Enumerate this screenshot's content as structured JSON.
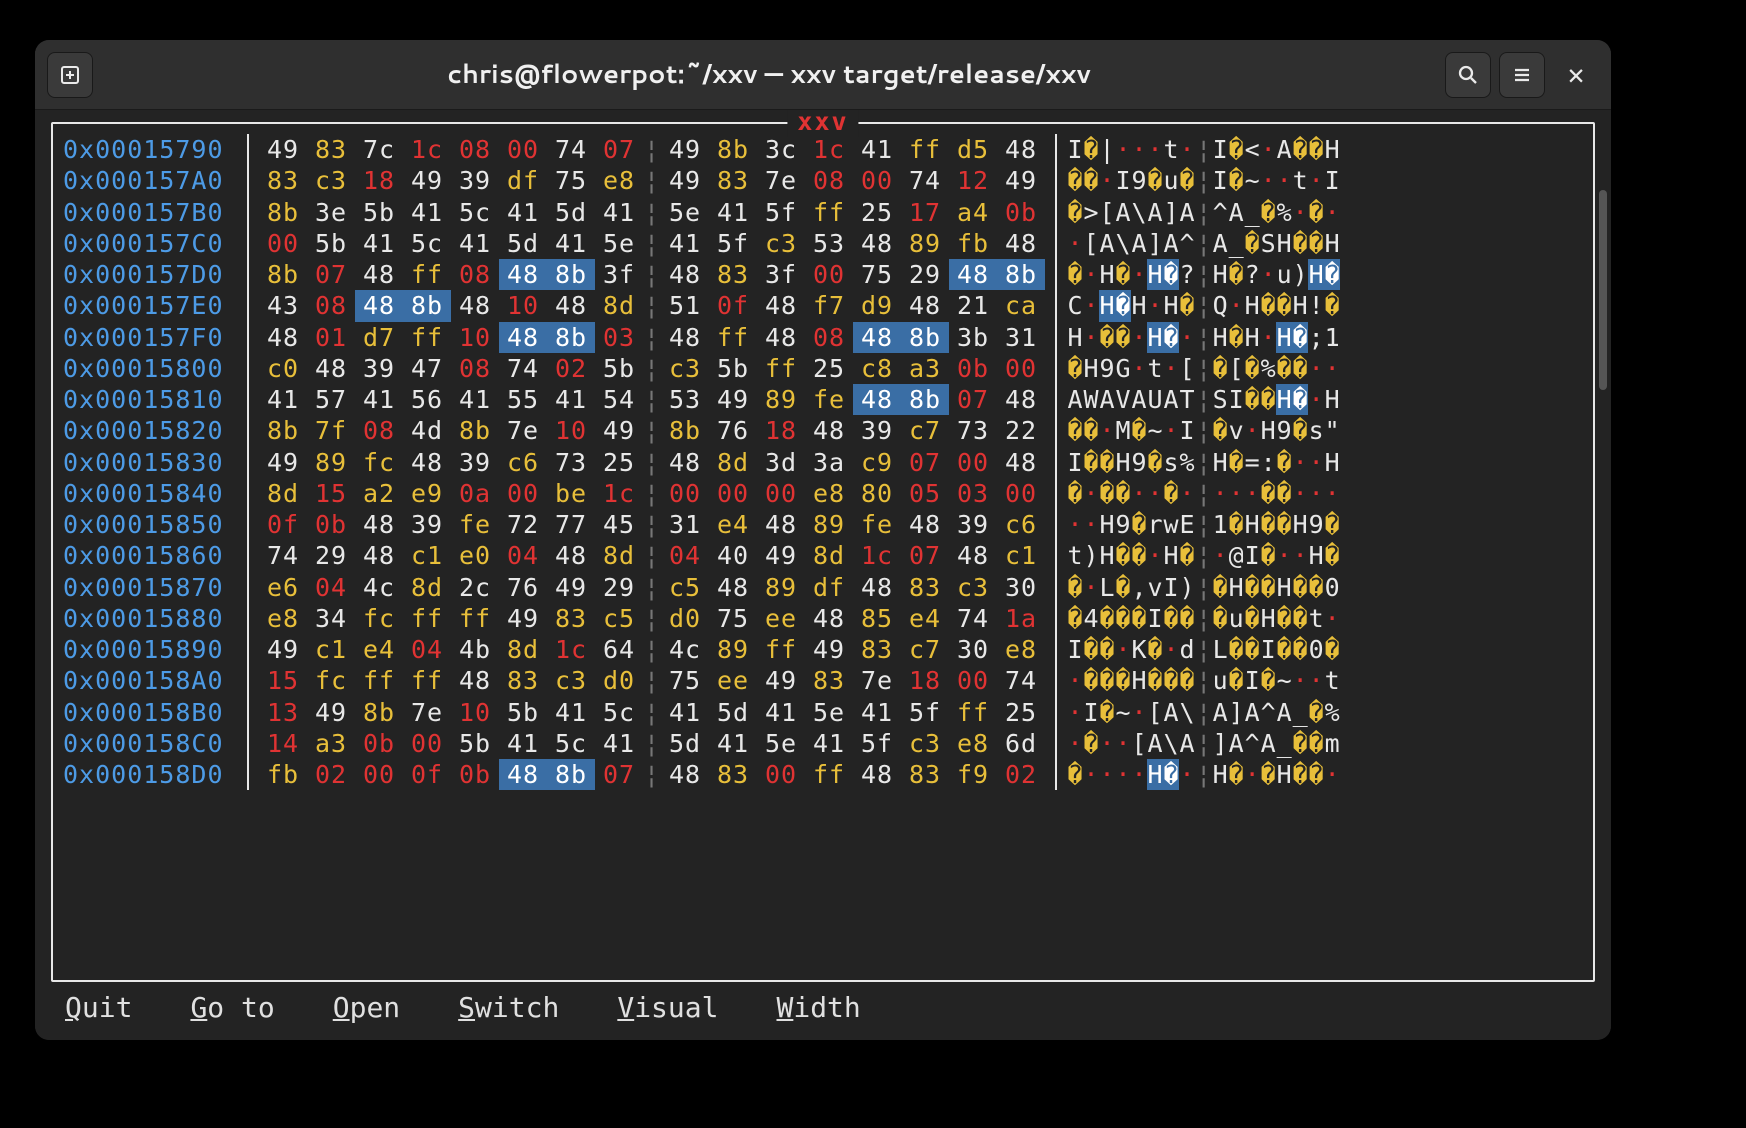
{
  "window": {
    "title": "chris@flowerpot:~/xxv — xxv target/release/xxv"
  },
  "viewer": {
    "title": "xxv",
    "highlight_pattern": [
      "48",
      "8b"
    ],
    "rows": [
      {
        "addr": "0x00015790",
        "bytes": [
          "49",
          "83",
          "7c",
          "1c",
          "08",
          "00",
          "74",
          "07",
          "49",
          "8b",
          "3c",
          "1c",
          "41",
          "ff",
          "d5",
          "48"
        ]
      },
      {
        "addr": "0x000157A0",
        "bytes": [
          "83",
          "c3",
          "18",
          "49",
          "39",
          "df",
          "75",
          "e8",
          "49",
          "83",
          "7e",
          "08",
          "00",
          "74",
          "12",
          "49"
        ]
      },
      {
        "addr": "0x000157B0",
        "bytes": [
          "8b",
          "3e",
          "5b",
          "41",
          "5c",
          "41",
          "5d",
          "41",
          "5e",
          "41",
          "5f",
          "ff",
          "25",
          "17",
          "a4",
          "0b"
        ]
      },
      {
        "addr": "0x000157C0",
        "bytes": [
          "00",
          "5b",
          "41",
          "5c",
          "41",
          "5d",
          "41",
          "5e",
          "41",
          "5f",
          "c3",
          "53",
          "48",
          "89",
          "fb",
          "48"
        ]
      },
      {
        "addr": "0x000157D0",
        "bytes": [
          "8b",
          "07",
          "48",
          "ff",
          "08",
          "48",
          "8b",
          "3f",
          "48",
          "83",
          "3f",
          "00",
          "75",
          "29",
          "48",
          "8b"
        ]
      },
      {
        "addr": "0x000157E0",
        "bytes": [
          "43",
          "08",
          "48",
          "8b",
          "48",
          "10",
          "48",
          "8d",
          "51",
          "0f",
          "48",
          "f7",
          "d9",
          "48",
          "21",
          "ca"
        ]
      },
      {
        "addr": "0x000157F0",
        "bytes": [
          "48",
          "01",
          "d7",
          "ff",
          "10",
          "48",
          "8b",
          "03",
          "48",
          "ff",
          "48",
          "08",
          "48",
          "8b",
          "3b",
          "31"
        ]
      },
      {
        "addr": "0x00015800",
        "bytes": [
          "c0",
          "48",
          "39",
          "47",
          "08",
          "74",
          "02",
          "5b",
          "c3",
          "5b",
          "ff",
          "25",
          "c8",
          "a3",
          "0b",
          "00"
        ]
      },
      {
        "addr": "0x00015810",
        "bytes": [
          "41",
          "57",
          "41",
          "56",
          "41",
          "55",
          "41",
          "54",
          "53",
          "49",
          "89",
          "fe",
          "48",
          "8b",
          "07",
          "48"
        ]
      },
      {
        "addr": "0x00015820",
        "bytes": [
          "8b",
          "7f",
          "08",
          "4d",
          "8b",
          "7e",
          "10",
          "49",
          "8b",
          "76",
          "18",
          "48",
          "39",
          "c7",
          "73",
          "22"
        ]
      },
      {
        "addr": "0x00015830",
        "bytes": [
          "49",
          "89",
          "fc",
          "48",
          "39",
          "c6",
          "73",
          "25",
          "48",
          "8d",
          "3d",
          "3a",
          "c9",
          "07",
          "00",
          "48"
        ]
      },
      {
        "addr": "0x00015840",
        "bytes": [
          "8d",
          "15",
          "a2",
          "e9",
          "0a",
          "00",
          "be",
          "1c",
          "00",
          "00",
          "00",
          "e8",
          "80",
          "05",
          "03",
          "00"
        ]
      },
      {
        "addr": "0x00015850",
        "bytes": [
          "0f",
          "0b",
          "48",
          "39",
          "fe",
          "72",
          "77",
          "45",
          "31",
          "e4",
          "48",
          "89",
          "fe",
          "48",
          "39",
          "c6"
        ]
      },
      {
        "addr": "0x00015860",
        "bytes": [
          "74",
          "29",
          "48",
          "c1",
          "e0",
          "04",
          "48",
          "8d",
          "04",
          "40",
          "49",
          "8d",
          "1c",
          "07",
          "48",
          "c1"
        ]
      },
      {
        "addr": "0x00015870",
        "bytes": [
          "e6",
          "04",
          "4c",
          "8d",
          "2c",
          "76",
          "49",
          "29",
          "c5",
          "48",
          "89",
          "df",
          "48",
          "83",
          "c3",
          "30"
        ]
      },
      {
        "addr": "0x00015880",
        "bytes": [
          "e8",
          "34",
          "fc",
          "ff",
          "ff",
          "49",
          "83",
          "c5",
          "d0",
          "75",
          "ee",
          "48",
          "85",
          "e4",
          "74",
          "1a"
        ]
      },
      {
        "addr": "0x00015890",
        "bytes": [
          "49",
          "c1",
          "e4",
          "04",
          "4b",
          "8d",
          "1c",
          "64",
          "4c",
          "89",
          "ff",
          "49",
          "83",
          "c7",
          "30",
          "e8"
        ]
      },
      {
        "addr": "0x000158A0",
        "bytes": [
          "15",
          "fc",
          "ff",
          "ff",
          "48",
          "83",
          "c3",
          "d0",
          "75",
          "ee",
          "49",
          "83",
          "7e",
          "18",
          "00",
          "74"
        ]
      },
      {
        "addr": "0x000158B0",
        "bytes": [
          "13",
          "49",
          "8b",
          "7e",
          "10",
          "5b",
          "41",
          "5c",
          "41",
          "5d",
          "41",
          "5e",
          "41",
          "5f",
          "ff",
          "25"
        ]
      },
      {
        "addr": "0x000158C0",
        "bytes": [
          "14",
          "a3",
          "0b",
          "00",
          "5b",
          "41",
          "5c",
          "41",
          "5d",
          "41",
          "5e",
          "41",
          "5f",
          "c3",
          "e8",
          "6d"
        ]
      },
      {
        "addr": "0x000158D0",
        "bytes": [
          "fb",
          "02",
          "00",
          "0f",
          "0b",
          "48",
          "8b",
          "07",
          "48",
          "83",
          "00",
          "ff",
          "48",
          "83",
          "f9",
          "02"
        ]
      }
    ]
  },
  "menu": [
    {
      "key": "Q",
      "label": "uit"
    },
    {
      "key": "G",
      "label": "o to"
    },
    {
      "key": "O",
      "label": "pen"
    },
    {
      "key": "S",
      "label": "witch"
    },
    {
      "key": "V",
      "label": "isual"
    },
    {
      "key": "W",
      "label": "idth"
    }
  ]
}
